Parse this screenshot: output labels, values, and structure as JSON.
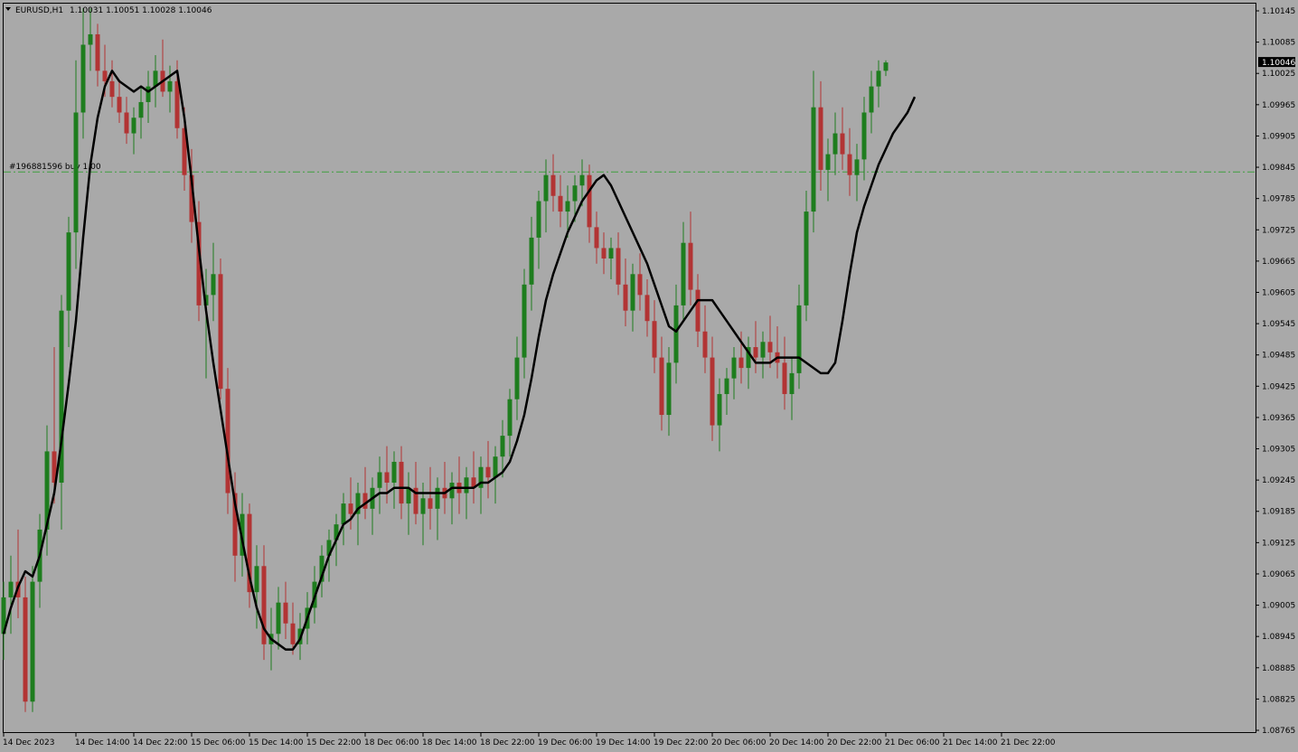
{
  "header": {
    "symbol": "EURUSD,H1",
    "ohlc": "1.10031 1.10051 1.10028 1.10046",
    "menu_icon": "triangle-down-icon"
  },
  "order_line": {
    "label": "#196881596 buy 1.00",
    "price": 1.09836,
    "color": "#3fa03f"
  },
  "current_price": {
    "label": "1.10046",
    "value": 1.10046
  },
  "colors": {
    "background": "#a9a9a9",
    "bull": "#1e7d1e",
    "bear": "#b23434",
    "ma": "#000000",
    "axis": "#000000"
  },
  "chart_data": {
    "type": "candlestick",
    "symbol": "EURUSD",
    "timeframe": "H1",
    "ylim": [
      1.08765,
      1.10145
    ],
    "y_ticks": [
      "1.10145",
      "1.10085",
      "1.10025",
      "1.09965",
      "1.09905",
      "1.09845",
      "1.09785",
      "1.09725",
      "1.09665",
      "1.09605",
      "1.09545",
      "1.09485",
      "1.09425",
      "1.09365",
      "1.09305",
      "1.09245",
      "1.09185",
      "1.09125",
      "1.09065",
      "1.09005",
      "1.08945",
      "1.08885",
      "1.08825",
      "1.08765"
    ],
    "x_ticks": [
      {
        "label": "14 Dec 2023",
        "index": 0
      },
      {
        "label": "14 Dec 14:00",
        "index": 10
      },
      {
        "label": "14 Dec 22:00",
        "index": 18
      },
      {
        "label": "15 Dec 06:00",
        "index": 26
      },
      {
        "label": "15 Dec 14:00",
        "index": 34
      },
      {
        "label": "15 Dec 22:00",
        "index": 42
      },
      {
        "label": "18 Dec 06:00",
        "index": 50
      },
      {
        "label": "18 Dec 14:00",
        "index": 58
      },
      {
        "label": "18 Dec 22:00",
        "index": 66
      },
      {
        "label": "19 Dec 06:00",
        "index": 74
      },
      {
        "label": "19 Dec 14:00",
        "index": 82
      },
      {
        "label": "19 Dec 22:00",
        "index": 90
      },
      {
        "label": "20 Dec 06:00",
        "index": 98
      },
      {
        "label": "20 Dec 14:00",
        "index": 106
      },
      {
        "label": "20 Dec 22:00",
        "index": 114
      },
      {
        "label": "21 Dec 06:00",
        "index": 122
      },
      {
        "label": "21 Dec 14:00",
        "index": 130
      },
      {
        "label": "21 Dec 22:00",
        "index": 138
      }
    ],
    "candles_ohlc": [
      [
        1.0895,
        1.0905,
        1.089,
        1.0902
      ],
      [
        1.0902,
        1.091,
        1.0895,
        1.0905
      ],
      [
        1.0905,
        1.0915,
        1.0898,
        1.0902
      ],
      [
        1.0902,
        1.0906,
        1.088,
        1.0882
      ],
      [
        1.0882,
        1.0908,
        1.088,
        1.0905
      ],
      [
        1.0905,
        1.0918,
        1.09,
        1.0915
      ],
      [
        1.0915,
        1.0935,
        1.091,
        1.093
      ],
      [
        1.093,
        1.095,
        1.092,
        1.0924
      ],
      [
        1.0924,
        1.096,
        1.0915,
        1.0957
      ],
      [
        1.0957,
        1.0975,
        1.095,
        1.0972
      ],
      [
        1.0972,
        1.1005,
        1.0965,
        1.0995
      ],
      [
        1.0995,
        1.1015,
        1.099,
        1.1008
      ],
      [
        1.1008,
        1.1015,
        1.1003,
        1.101
      ],
      [
        1.101,
        1.1012,
        1.1,
        1.1003
      ],
      [
        1.1003,
        1.1008,
        1.0998,
        1.1001
      ],
      [
        1.1001,
        1.1005,
        1.0996,
        1.0998
      ],
      [
        1.0998,
        1.1001,
        1.0993,
        1.0995
      ],
      [
        1.0995,
        1.0998,
        1.0989,
        1.0991
      ],
      [
        1.0991,
        1.0996,
        1.0987,
        1.0994
      ],
      [
        1.0994,
        1.1,
        1.099,
        1.0997
      ],
      [
        1.0997,
        1.1003,
        1.0993,
        1.1
      ],
      [
        1.1,
        1.1006,
        1.0996,
        1.1003
      ],
      [
        1.1003,
        1.1009,
        1.0998,
        1.0999
      ],
      [
        1.0999,
        1.1004,
        1.0995,
        1.1001
      ],
      [
        1.1001,
        1.1005,
        1.099,
        1.0992
      ],
      [
        1.0992,
        1.0996,
        1.098,
        1.0983
      ],
      [
        1.0983,
        1.0988,
        1.097,
        1.0974
      ],
      [
        1.0974,
        1.0978,
        1.0955,
        1.0958
      ],
      [
        1.0958,
        1.0965,
        1.0944,
        1.096
      ],
      [
        1.096,
        1.097,
        1.0955,
        1.0964
      ],
      [
        1.0964,
        1.0967,
        1.094,
        1.0942
      ],
      [
        1.0942,
        1.0946,
        1.0918,
        1.0922
      ],
      [
        1.0922,
        1.0926,
        1.0905,
        1.091
      ],
      [
        1.091,
        1.0922,
        1.0906,
        1.0918
      ],
      [
        1.0918,
        1.092,
        1.09,
        1.0903
      ],
      [
        1.0903,
        1.0912,
        1.0896,
        1.0908
      ],
      [
        1.0908,
        1.0912,
        1.089,
        1.0893
      ],
      [
        1.0893,
        1.09,
        1.0888,
        1.0895
      ],
      [
        1.0895,
        1.0904,
        1.0892,
        1.0901
      ],
      [
        1.0901,
        1.0905,
        1.0894,
        1.0897
      ],
      [
        1.0897,
        1.0901,
        1.0891,
        1.0893
      ],
      [
        1.0893,
        1.0899,
        1.089,
        1.0896
      ],
      [
        1.0896,
        1.0903,
        1.0893,
        1.09
      ],
      [
        1.09,
        1.0908,
        1.0897,
        1.0905
      ],
      [
        1.0905,
        1.0912,
        1.0902,
        1.091
      ],
      [
        1.091,
        1.0915,
        1.0905,
        1.0913
      ],
      [
        1.0913,
        1.0918,
        1.0908,
        1.0916
      ],
      [
        1.0916,
        1.0922,
        1.0912,
        1.092
      ],
      [
        1.092,
        1.0925,
        1.0915,
        1.0918
      ],
      [
        1.0918,
        1.0924,
        1.0912,
        1.0922
      ],
      [
        1.0922,
        1.0927,
        1.0917,
        1.0919
      ],
      [
        1.0919,
        1.0925,
        1.0914,
        1.0923
      ],
      [
        1.0923,
        1.0929,
        1.0918,
        1.0926
      ],
      [
        1.0926,
        1.0931,
        1.092,
        1.0924
      ],
      [
        1.0924,
        1.093,
        1.0919,
        1.0928
      ],
      [
        1.0928,
        1.0931,
        1.0917,
        1.092
      ],
      [
        1.092,
        1.0926,
        1.0914,
        1.0923
      ],
      [
        1.0923,
        1.0928,
        1.0916,
        1.0918
      ],
      [
        1.0918,
        1.0924,
        1.0912,
        1.0921
      ],
      [
        1.0921,
        1.0927,
        1.0915,
        1.0919
      ],
      [
        1.0919,
        1.0925,
        1.0913,
        1.0923
      ],
      [
        1.0923,
        1.0928,
        1.0918,
        1.0921
      ],
      [
        1.0921,
        1.0926,
        1.0916,
        1.0924
      ],
      [
        1.0924,
        1.0929,
        1.0918,
        1.0922
      ],
      [
        1.0922,
        1.0927,
        1.0917,
        1.0925
      ],
      [
        1.0925,
        1.093,
        1.092,
        1.0923
      ],
      [
        1.0923,
        1.0929,
        1.0918,
        1.0927
      ],
      [
        1.0927,
        1.0932,
        1.0921,
        1.0925
      ],
      [
        1.0925,
        1.0931,
        1.092,
        1.0929
      ],
      [
        1.0929,
        1.0936,
        1.0925,
        1.0933
      ],
      [
        1.0933,
        1.0942,
        1.0929,
        1.094
      ],
      [
        1.094,
        1.0952,
        1.0936,
        1.0948
      ],
      [
        1.0948,
        1.0965,
        1.0944,
        1.0962
      ],
      [
        1.0962,
        1.0975,
        1.0957,
        1.0971
      ],
      [
        1.0971,
        1.098,
        1.0965,
        1.0978
      ],
      [
        1.0978,
        1.0986,
        1.0972,
        1.0983
      ],
      [
        1.0983,
        1.0987,
        1.0976,
        1.0979
      ],
      [
        1.0979,
        1.0983,
        1.0973,
        1.0976
      ],
      [
        1.0976,
        1.0981,
        1.0971,
        1.0978
      ],
      [
        1.0978,
        1.0983,
        1.0974,
        1.0981
      ],
      [
        1.0981,
        1.0986,
        1.0977,
        1.0983
      ],
      [
        1.0983,
        1.0985,
        1.097,
        1.0973
      ],
      [
        1.0973,
        1.0976,
        1.0966,
        1.0969
      ],
      [
        1.0969,
        1.0972,
        1.0964,
        1.0967
      ],
      [
        1.0967,
        1.0971,
        1.0963,
        1.0969
      ],
      [
        1.0969,
        1.0972,
        1.096,
        1.0962
      ],
      [
        1.0962,
        1.0967,
        1.0954,
        1.0957
      ],
      [
        1.0957,
        1.0966,
        1.0953,
        1.0964
      ],
      [
        1.0964,
        1.0968,
        1.0957,
        1.096
      ],
      [
        1.096,
        1.0963,
        1.0952,
        1.0955
      ],
      [
        1.0955,
        1.0959,
        1.0945,
        1.0948
      ],
      [
        1.0948,
        1.0952,
        1.0934,
        1.0937
      ],
      [
        1.0937,
        1.095,
        1.0933,
        1.0947
      ],
      [
        1.0947,
        1.0962,
        1.0943,
        1.0958
      ],
      [
        1.0958,
        1.0974,
        1.0955,
        1.097
      ],
      [
        1.097,
        1.0976,
        1.0958,
        1.0961
      ],
      [
        1.0961,
        1.0964,
        1.095,
        1.0953
      ],
      [
        1.0953,
        1.0958,
        1.0945,
        1.0948
      ],
      [
        1.0948,
        1.0952,
        1.0932,
        1.0935
      ],
      [
        1.0935,
        1.0944,
        1.093,
        1.0941
      ],
      [
        1.0941,
        1.0946,
        1.0937,
        1.0944
      ],
      [
        1.0944,
        1.095,
        1.094,
        1.0948
      ],
      [
        1.0948,
        1.0953,
        1.0943,
        1.0946
      ],
      [
        1.0946,
        1.0952,
        1.0942,
        1.095
      ],
      [
        1.095,
        1.0955,
        1.0945,
        1.0948
      ],
      [
        1.0948,
        1.0953,
        1.0944,
        1.0951
      ],
      [
        1.0951,
        1.0956,
        1.0946,
        1.0949
      ],
      [
        1.0949,
        1.0954,
        1.0944,
        1.0947
      ],
      [
        1.0947,
        1.0952,
        1.0938,
        1.0941
      ],
      [
        1.0941,
        1.0948,
        1.0936,
        1.0945
      ],
      [
        1.0945,
        1.0962,
        1.0942,
        1.0958
      ],
      [
        1.0958,
        1.098,
        1.0955,
        1.0976
      ],
      [
        1.0976,
        1.1003,
        1.0972,
        1.0996
      ],
      [
        1.0996,
        1.1001,
        1.098,
        1.0984
      ],
      [
        1.0984,
        1.099,
        1.0978,
        1.0987
      ],
      [
        1.0987,
        1.0995,
        1.0983,
        1.0991
      ],
      [
        1.0991,
        1.0996,
        1.0984,
        1.0987
      ],
      [
        1.0987,
        1.0992,
        1.0979,
        1.0983
      ],
      [
        1.0983,
        1.0989,
        1.0978,
        1.0986
      ],
      [
        1.0986,
        1.0998,
        1.0982,
        1.0995
      ],
      [
        1.0995,
        1.1003,
        1.0991,
        1.1
      ],
      [
        1.1,
        1.1005,
        1.0996,
        1.1003
      ],
      [
        1.1003,
        1.1005,
        1.1002,
        1.10046
      ]
    ],
    "ma_series": [
      1.0895,
      1.09,
      1.0904,
      1.0907,
      1.0906,
      1.091,
      1.0916,
      1.0922,
      1.0932,
      1.0943,
      1.0955,
      1.0971,
      1.0985,
      1.0994,
      1.1,
      1.1003,
      1.1001,
      1.1,
      1.0999,
      1.1,
      1.0999,
      1.1,
      1.1001,
      1.1002,
      1.1003,
      1.0994,
      1.0982,
      1.0969,
      1.0957,
      1.0947,
      1.0938,
      1.0929,
      1.092,
      1.0913,
      1.0906,
      1.09,
      1.0896,
      1.0894,
      1.0893,
      1.0892,
      1.0892,
      1.0894,
      1.0898,
      1.0902,
      1.0906,
      1.091,
      1.0913,
      1.0916,
      1.0917,
      1.0919,
      1.092,
      1.0921,
      1.0922,
      1.0922,
      1.0923,
      1.0923,
      1.0923,
      1.0922,
      1.0922,
      1.0922,
      1.0922,
      1.0922,
      1.0923,
      1.0923,
      1.0923,
      1.0923,
      1.0924,
      1.0924,
      1.0925,
      1.0926,
      1.0928,
      1.0932,
      1.0937,
      1.0944,
      1.0952,
      1.0959,
      1.0964,
      1.0968,
      1.0972,
      1.0975,
      1.0978,
      1.098,
      1.0982,
      1.0983,
      1.0981,
      1.0978,
      1.0975,
      1.0972,
      1.0969,
      1.0966,
      1.0962,
      1.0958,
      1.0954,
      1.0953,
      1.0955,
      1.0957,
      1.0959,
      1.0959,
      1.0959,
      1.0957,
      1.0955,
      1.0953,
      1.0951,
      1.0949,
      1.0947,
      1.0947,
      1.0947,
      1.0948,
      1.0948,
      1.0948,
      1.0948,
      1.0947,
      1.0946,
      1.0945,
      1.0945,
      1.0947,
      1.0955,
      1.0964,
      1.0972,
      1.0977,
      1.0981,
      1.0985,
      1.0988,
      1.0991,
      1.0993,
      1.0995,
      1.0998
    ]
  }
}
